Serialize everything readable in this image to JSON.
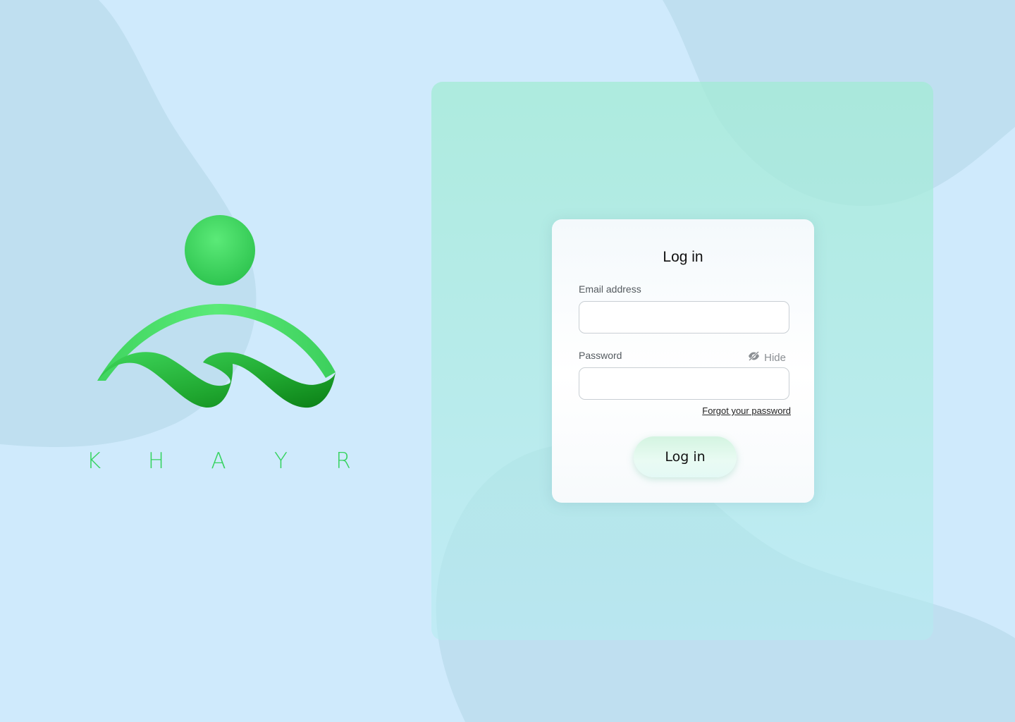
{
  "brand": {
    "name_letters": [
      "K",
      "H",
      "A",
      "Y",
      "R"
    ]
  },
  "login": {
    "title": "Log in",
    "email_label": "Email address",
    "email_value": "",
    "password_label": "Password",
    "password_value": "",
    "hide_label": "Hide",
    "forgot_label": "Forgot your password",
    "submit_label": "Log in"
  },
  "icons": {
    "password_toggle": "eye-slash-icon",
    "logo": "khayr-logo"
  },
  "colors": {
    "background": "#cfeafc",
    "blob": "#bfdff0",
    "panel": "#b0ead9",
    "brand_green": "#35d35f",
    "logo_green_light": "#5bea78",
    "logo_green_dark": "#0b8c1c"
  }
}
